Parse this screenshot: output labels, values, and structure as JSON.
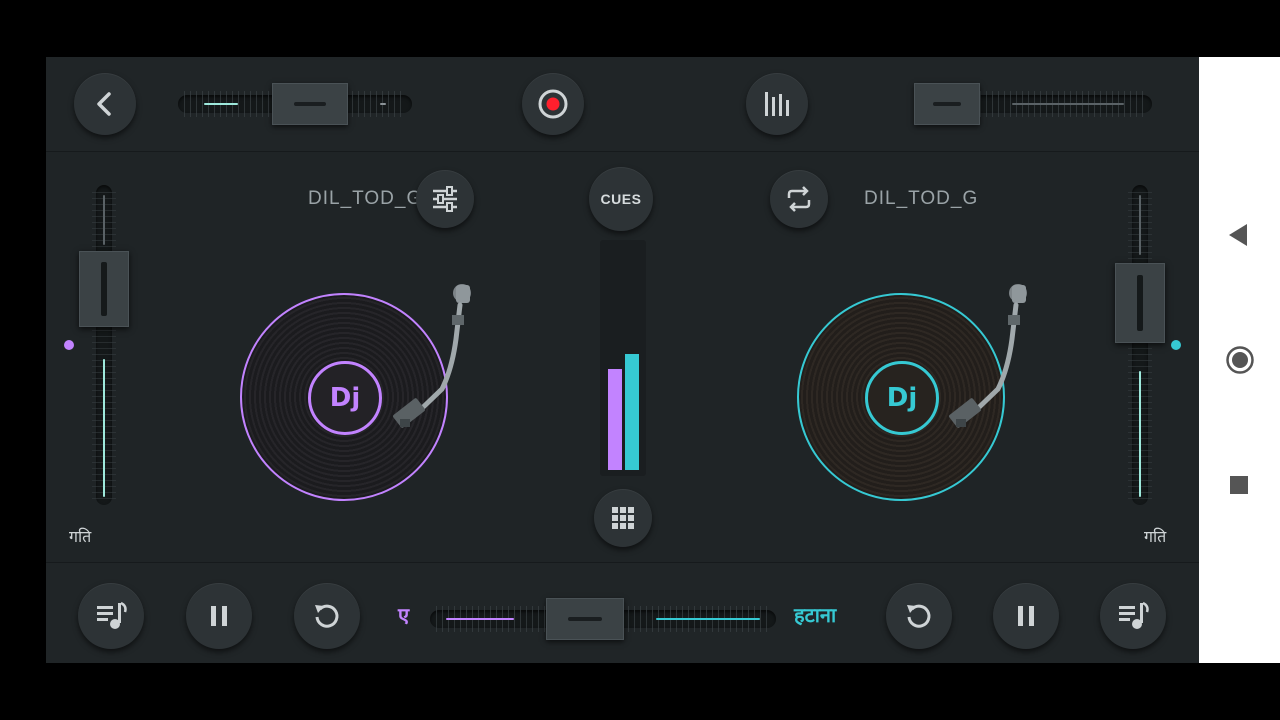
{
  "deck_a": {
    "track_title": "DIL_TOD_G",
    "speed_label": "गति",
    "accent": "#c283ff",
    "pitch": 0.45
  },
  "deck_b": {
    "track_title": "DIL_TOD_G",
    "speed_label": "गति",
    "accent": "#36c9d3",
    "pitch": 0.5
  },
  "center": {
    "cues_label": "CUES",
    "logo_a": "Dj",
    "logo_b": "Dj",
    "meter_a": 0.45,
    "meter_b": 0.52
  },
  "crossfader": {
    "left_label": "ए",
    "right_label": "हटाना"
  },
  "icons": {
    "back": "chevron-left-icon",
    "record": "record-icon",
    "equalizer": "bars-icon",
    "fx": "sliders-icon",
    "loop": "repeat-icon",
    "grid": "grid-icon",
    "music": "playlist-icon",
    "pause": "pause-icon",
    "rewind": "rotate-left-icon",
    "nav_back": "triangle-left-icon",
    "nav_home": "circle-icon",
    "nav_recent": "square-icon"
  },
  "colors": {
    "background": "#1f2426",
    "purple": "#c283ff",
    "cyan": "#36c9d3",
    "record_red": "#ff1f2d"
  }
}
